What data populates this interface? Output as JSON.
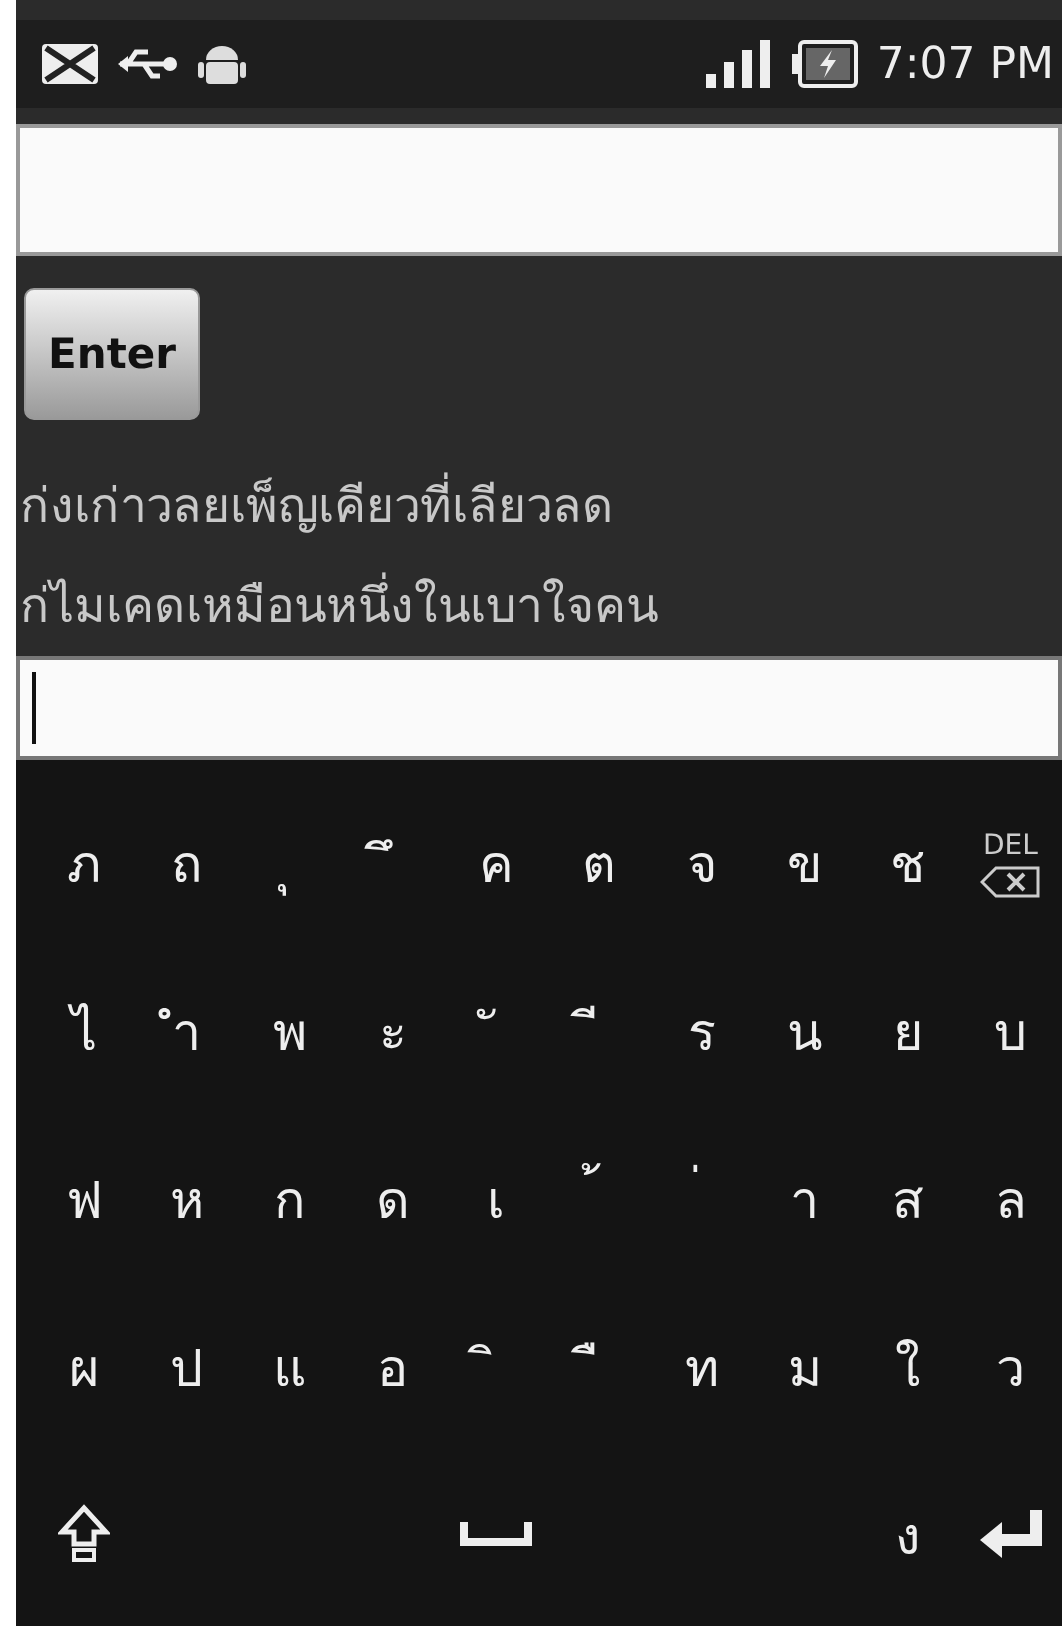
{
  "status_bar": {
    "time": "7:07 PM"
  },
  "enter_button": {
    "label": "Enter"
  },
  "output_lines": [
    "ก่งเก่าวลยเพ็ญเคียวที่เลียวลด",
    "ก่ไมเคดเหมือนหนึ่งในเบาใจคน"
  ],
  "input_bottom": {
    "focused": true
  },
  "keyboard": {
    "rows": [
      [
        {
          "kind": "char",
          "label": "ภ"
        },
        {
          "kind": "char",
          "label": "ถ"
        },
        {
          "kind": "char",
          "label": "ุ"
        },
        {
          "kind": "char",
          "label": "ึ"
        },
        {
          "kind": "char",
          "label": "ค"
        },
        {
          "kind": "char",
          "label": "ต"
        },
        {
          "kind": "char",
          "label": "จ"
        },
        {
          "kind": "char",
          "label": "ข"
        },
        {
          "kind": "char",
          "label": "ช"
        },
        {
          "kind": "delete",
          "label": "DEL"
        }
      ],
      [
        {
          "kind": "char",
          "label": "ไ"
        },
        {
          "kind": "char",
          "label": "ำ"
        },
        {
          "kind": "char",
          "label": "พ"
        },
        {
          "kind": "char",
          "label": "ะ"
        },
        {
          "kind": "char",
          "label": "ั"
        },
        {
          "kind": "char",
          "label": "ี"
        },
        {
          "kind": "char",
          "label": "ร"
        },
        {
          "kind": "char",
          "label": "น"
        },
        {
          "kind": "char",
          "label": "ย"
        },
        {
          "kind": "char",
          "label": "บ"
        }
      ],
      [
        {
          "kind": "char",
          "label": "ฟ"
        },
        {
          "kind": "char",
          "label": "ห"
        },
        {
          "kind": "char",
          "label": "ก"
        },
        {
          "kind": "char",
          "label": "ด"
        },
        {
          "kind": "char",
          "label": "เ"
        },
        {
          "kind": "char",
          "label": "้"
        },
        {
          "kind": "char",
          "label": "่"
        },
        {
          "kind": "char",
          "label": "า"
        },
        {
          "kind": "char",
          "label": "ส"
        },
        {
          "kind": "char",
          "label": "ล"
        }
      ],
      [
        {
          "kind": "char",
          "label": "ผ"
        },
        {
          "kind": "char",
          "label": "ป"
        },
        {
          "kind": "char",
          "label": "แ"
        },
        {
          "kind": "char",
          "label": "อ"
        },
        {
          "kind": "char",
          "label": "ิ"
        },
        {
          "kind": "char",
          "label": "ื"
        },
        {
          "kind": "char",
          "label": "ท"
        },
        {
          "kind": "char",
          "label": "ม"
        },
        {
          "kind": "char",
          "label": "ใ"
        },
        {
          "kind": "char",
          "label": "ว"
        }
      ],
      [
        {
          "kind": "shift"
        },
        {
          "kind": "gap"
        },
        {
          "kind": "gap"
        },
        {
          "kind": "gap"
        },
        {
          "kind": "space"
        },
        {
          "kind": "gap"
        },
        {
          "kind": "gap"
        },
        {
          "kind": "gap"
        },
        {
          "kind": "char",
          "label": "ง"
        },
        {
          "kind": "enter"
        }
      ]
    ]
  }
}
